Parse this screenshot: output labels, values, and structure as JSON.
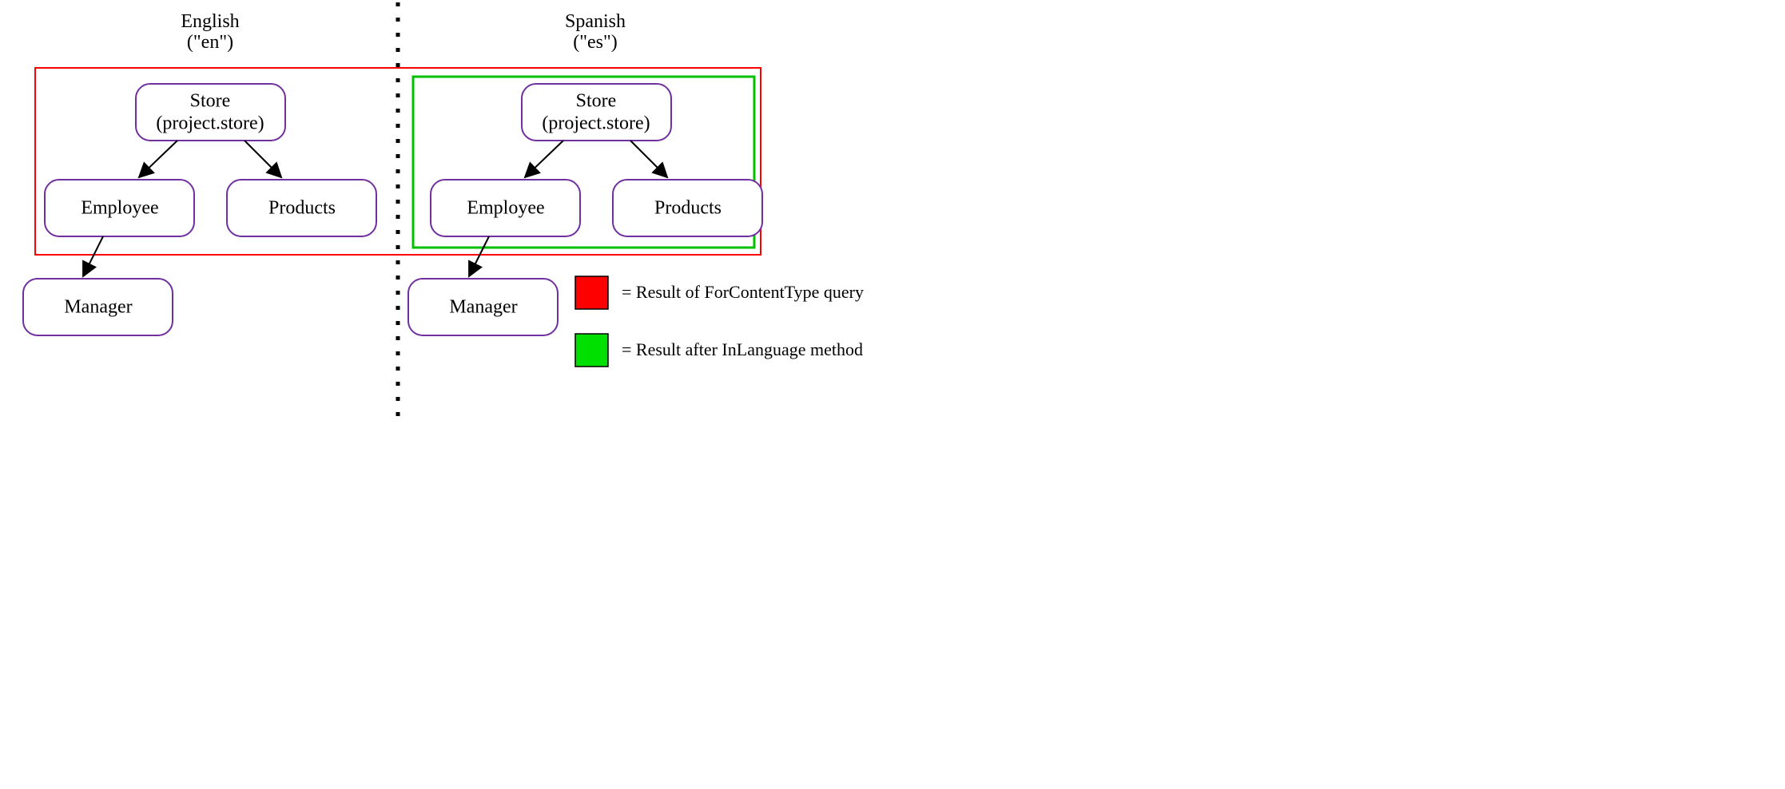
{
  "headers": {
    "english_label": "English",
    "english_code": "(\"en\")",
    "spanish_label": "Spanish",
    "spanish_code": "(\"es\")"
  },
  "nodes": {
    "store_title": "Store",
    "store_subtitle": "(project.store)",
    "employee": "Employee",
    "products": "Products",
    "manager": "Manager"
  },
  "legend": {
    "red_label": "= Result of ForContentType query",
    "green_label": "= Result after InLanguage method"
  },
  "colors": {
    "node_border": "#7030a0",
    "red": "#ff0000",
    "green": "#00c000"
  }
}
